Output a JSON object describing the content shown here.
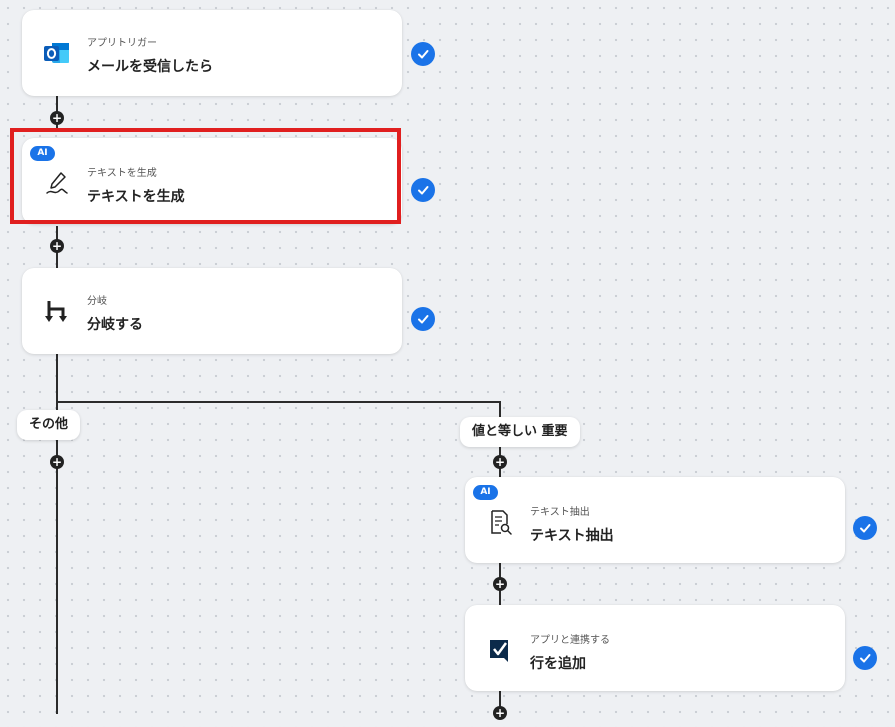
{
  "steps": [
    {
      "subtitle": "アプリトリガー",
      "title": "メールを受信したら",
      "icon": "outlook-icon",
      "ai": false,
      "status": "completed"
    },
    {
      "subtitle": "テキストを生成",
      "title": "テキストを生成",
      "icon": "pen-icon",
      "ai": true,
      "status": "completed"
    },
    {
      "subtitle": "分岐",
      "title": "分岐する",
      "icon": "branch-icon",
      "ai": false,
      "status": "completed"
    },
    {
      "subtitle": "テキスト抽出",
      "title": "テキスト抽出",
      "icon": "document-search-icon",
      "ai": true,
      "status": "completed"
    },
    {
      "subtitle": "アプリと連携する",
      "title": "行を追加",
      "icon": "smartsheet-icon",
      "ai": false,
      "status": "completed"
    }
  ],
  "branches": {
    "other_label": "その他",
    "match_label": "値と等しい 重要"
  },
  "badges": {
    "ai": "AI"
  },
  "add_symbol": "+",
  "colors": {
    "accent": "#1a73e8",
    "highlight": "#e01f1f",
    "connector": "#2b2b2b"
  }
}
